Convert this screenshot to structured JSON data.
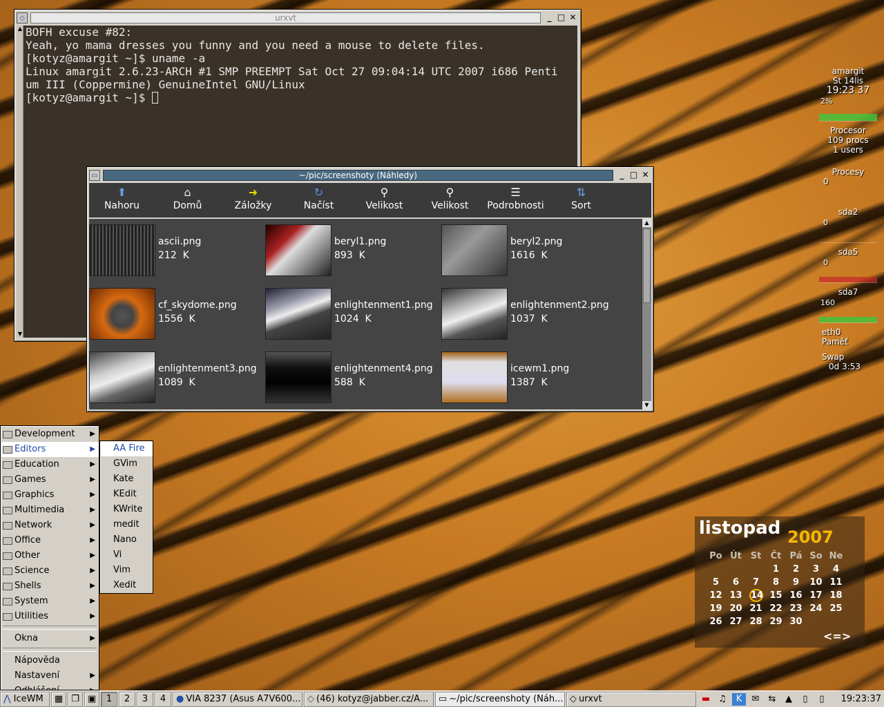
{
  "terminal": {
    "title": "urxvt",
    "lines": [
      "BOFH excuse #82:",
      "",
      "Yeah, yo mama dresses you funny and you need a mouse to delete files.",
      "[kotyz@amargit ~]$ uname -a",
      "Linux amargit 2.6.23-ARCH #1 SMP PREEMPT Sat Oct 27 09:04:14 UTC 2007 i686 Penti",
      "um III (Coppermine) GenuineIntel GNU/Linux",
      "[kotyz@amargit ~]$ "
    ]
  },
  "filemanager": {
    "title": "~/pic/screenshoty (Náhledy)",
    "toolbar": [
      {
        "label": "Nahoru",
        "icon": "up-icon"
      },
      {
        "label": "Domů",
        "icon": "home-icon"
      },
      {
        "label": "Záložky",
        "icon": "bookmarks-icon"
      },
      {
        "label": "Načíst",
        "icon": "reload-icon"
      },
      {
        "label": "Velikost",
        "icon": "zoom-in-icon"
      },
      {
        "label": "Velikost",
        "icon": "zoom-out-icon"
      },
      {
        "label": "Podrobnosti",
        "icon": "details-icon"
      },
      {
        "label": "Sort",
        "icon": "sort-icon"
      }
    ],
    "files": [
      {
        "name": "ascii.png",
        "size": "212  K"
      },
      {
        "name": "beryl1.png",
        "size": "893  K"
      },
      {
        "name": "beryl2.png",
        "size": "1616  K"
      },
      {
        "name": "cf_skydome.png",
        "size": "1556  K"
      },
      {
        "name": "enlightenment1.png",
        "size": "1024  K"
      },
      {
        "name": "enlightenment2.png",
        "size": "1037  K"
      },
      {
        "name": "enlightenment3.png",
        "size": "1089  K"
      },
      {
        "name": "enlightenment4.png",
        "size": "588  K"
      },
      {
        "name": "icewm1.png",
        "size": "1387  K"
      }
    ]
  },
  "startmenu": {
    "categories": [
      "Development",
      "Editors",
      "Education",
      "Games",
      "Graphics",
      "Multimedia",
      "Network",
      "Office",
      "Other",
      "Science",
      "Shells",
      "System",
      "Utilities"
    ],
    "selected": "Editors",
    "windows": "Okna",
    "help": "Nápověda",
    "settings": "Nastavení",
    "logout": "Odhlášení..."
  },
  "submenu": {
    "items": [
      "AA Fire",
      "GVim",
      "Kate",
      "KEdit",
      "KWrite",
      "medit",
      "Nano",
      "Vi",
      "Vim",
      "Xedit"
    ]
  },
  "taskbar": {
    "start_label": "IceWM",
    "workspaces": [
      "1",
      "2",
      "3",
      "4"
    ],
    "active_workspace": "1",
    "tasks": [
      "VIA 8237 (Asus A7V600...",
      "(46) kotyz@jabber.cz/A...",
      "~/pic/screenshoty (Náh...",
      "urxvt"
    ],
    "clock": "19:23:37"
  },
  "monitor": {
    "host": "amargit",
    "date": "St  14lis",
    "time": "19:23 37",
    "cpu_percent": "2%",
    "cpu_label": "Procesor",
    "procs": "109 procs",
    "users": "1 users",
    "procesy_label": "Procesy",
    "procesy_val": "0",
    "disks": [
      {
        "name": "sda2",
        "val": "0"
      },
      {
        "name": "sda5",
        "val": "0"
      },
      {
        "name": "sda7",
        "val": "160"
      }
    ],
    "net": "eth0",
    "mem": "Paměť",
    "swap": "Swap",
    "uptime": "0d  3:53"
  },
  "calendar": {
    "month": "listopad",
    "year": "2007",
    "days_header": [
      "Po",
      "Út",
      "St",
      "Čt",
      "Pá",
      "So",
      "Ne"
    ],
    "weeks": [
      [
        "",
        "",
        "",
        "1",
        "2",
        "3",
        "4"
      ],
      [
        "5",
        "6",
        "7",
        "8",
        "9",
        "10",
        "11"
      ],
      [
        "12",
        "13",
        "14",
        "15",
        "16",
        "17",
        "18"
      ],
      [
        "19",
        "20",
        "21",
        "22",
        "23",
        "24",
        "25"
      ],
      [
        "26",
        "27",
        "28",
        "29",
        "30",
        "",
        ""
      ]
    ],
    "today": "14",
    "nav": "<=>"
  }
}
